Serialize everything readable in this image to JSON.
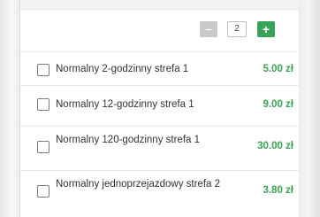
{
  "header": {
    "text": ""
  },
  "quantity": {
    "minus_label": "−",
    "value": "2",
    "plus_label": "+"
  },
  "tickets": [
    {
      "name": "Normalny 2-godzinny strefa 1",
      "price": "5.00 zł"
    },
    {
      "name": "Normalny 12-godzinny strefa 1",
      "price": "9.00 zł"
    },
    {
      "name": "Normalny 120-godzinny strefa 1",
      "price": "30.00 zł"
    },
    {
      "name": "Normalny jednoprzejazdowy strefa 2",
      "price": "3.80 zł"
    }
  ],
  "colors": {
    "accent_green": "#3aa35a",
    "price_green": "#38a554",
    "minus_gray": "#c9c9c9"
  }
}
